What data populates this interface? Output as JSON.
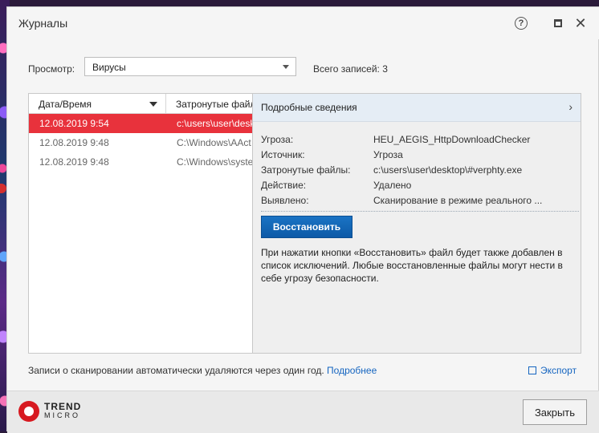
{
  "window": {
    "title": "Журналы"
  },
  "view": {
    "label": "Просмотр:",
    "selected": "Вирусы"
  },
  "total_records": "Всего записей: 3",
  "table": {
    "columns": [
      "Дата/Время",
      "Затронутые файл"
    ],
    "rows": [
      {
        "datetime": "12.08.2019 9:54",
        "file": "c:\\users\\user\\desk"
      },
      {
        "datetime": "12.08.2019 9:48",
        "file": "C:\\Windows\\AAct"
      },
      {
        "datetime": "12.08.2019 9:48",
        "file": "C:\\Windows\\syste"
      }
    ],
    "selected_row": 0
  },
  "details": {
    "header": "Подробные сведения",
    "fields": [
      {
        "label": "Угроза:",
        "value": "HEU_AEGIS_HttpDownloadChecker"
      },
      {
        "label": "Источник:",
        "value": "Угроза"
      },
      {
        "label": "Затронутые файлы:",
        "value": "c:\\users\\user\\desktop\\#verphty.exe"
      },
      {
        "label": "Действие:",
        "value": "Удалено"
      },
      {
        "label": "Выявлено:",
        "value": "Сканирование в режиме реального ..."
      }
    ],
    "restore_button": "Восстановить",
    "note": "При нажатии кнопки «Восстановить» файл будет также добавлен в список исключений. Любые восстановленные файлы могут нести в себе угрозу безопасности."
  },
  "footer": {
    "note": "Записи о сканировании автоматически удаляются через один год.",
    "more_link": "Подробнее",
    "export": "Экспорт",
    "close_button": "Закрыть",
    "logo_line1": "TREND",
    "logo_line2": "MICRO"
  },
  "colors": {
    "selected_row": "#e8323c",
    "accent": "#0d5aa7",
    "link": "#1565c0"
  }
}
